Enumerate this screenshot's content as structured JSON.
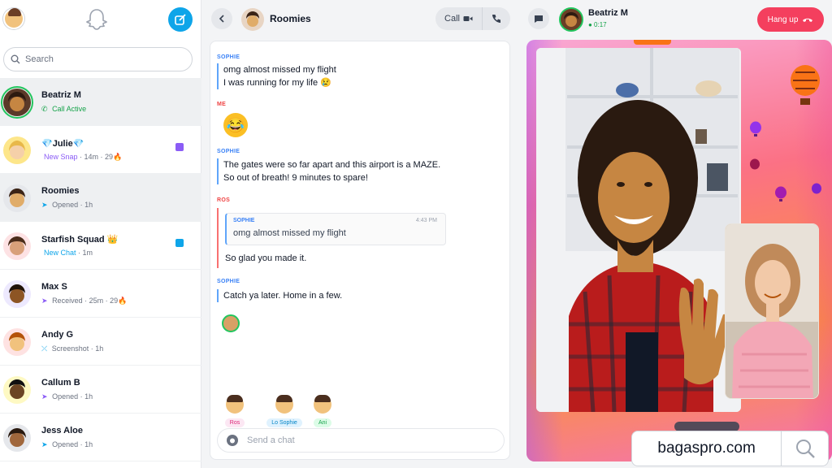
{
  "sidebar": {
    "search_placeholder": "Search",
    "conversations": [
      {
        "name": "Beatriz M",
        "status": "Call Active",
        "status_kind": "call",
        "time": "",
        "streak": ""
      },
      {
        "name": "💎Julie💎",
        "status": "New Snap",
        "status_kind": "snap",
        "time": "14m",
        "streak": "29🔥"
      },
      {
        "name": "Roomies",
        "status": "Opened",
        "status_kind": "opened",
        "time": "1h",
        "streak": ""
      },
      {
        "name": "Starfish Squad 👑",
        "status": "New Chat",
        "status_kind": "chat",
        "time": "1m",
        "streak": ""
      },
      {
        "name": "Max S",
        "status": "Received",
        "status_kind": "received",
        "time": "25m",
        "streak": "29🔥"
      },
      {
        "name": "Andy G",
        "status": "Screenshot",
        "status_kind": "screenshot",
        "time": "1h",
        "streak": ""
      },
      {
        "name": "Callum B",
        "status": "Opened",
        "status_kind": "opened",
        "time": "1h",
        "streak": ""
      },
      {
        "name": "Jess Aloe",
        "status": "Opened",
        "status_kind": "opened",
        "time": "1h",
        "streak": ""
      }
    ]
  },
  "chat": {
    "title": "Roomies",
    "call_label": "Call",
    "messages": [
      {
        "sender": "SOPHIE",
        "lines": [
          "omg almost missed my flight",
          "I was running for my life 😢"
        ]
      },
      {
        "sender": "ME",
        "sticker": "😂"
      },
      {
        "sender": "SOPHIE",
        "lines": [
          "The gates were so far apart and this airport is a MAZE.",
          "So out of breath! 9 minutes to spare!"
        ]
      },
      {
        "sender": "ROS",
        "quote_sender": "SOPHIE",
        "quote_time": "4:43 PM",
        "quote_text": "omg almost missed my flight",
        "text": "So glad you made it."
      },
      {
        "sender": "SOPHIE",
        "lines": [
          "Catch ya later. Home in a few."
        ]
      }
    ],
    "present": [
      {
        "label": "Ros",
        "bg": "#fce7f3",
        "fg": "#db2777"
      },
      {
        "label": "Lo Sophie",
        "bg": "#e0f2fe",
        "fg": "#0284c7"
      },
      {
        "label": "Ani",
        "bg": "#dcfce7",
        "fg": "#16a34a"
      }
    ],
    "composer_placeholder": "Send a chat"
  },
  "call": {
    "caller_name": "Beatriz M",
    "caller_status": "● 0:17",
    "hangup_label": "Hang up"
  },
  "watermark": {
    "text": "bagaspro.com"
  },
  "colors": {
    "accent": "#0ea5e9",
    "hangup": "#f43f5e",
    "call_active": "#16a34a",
    "new_snap": "#8b5cf6",
    "new_chat": "#0ea5e9"
  }
}
